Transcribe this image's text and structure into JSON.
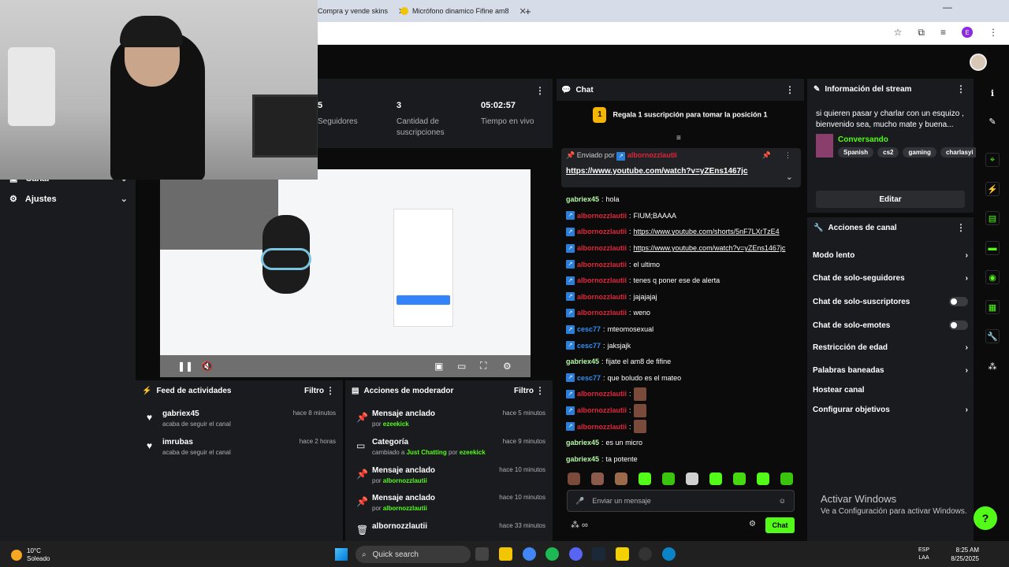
{
  "browser": {
    "tabs": [
      {
        "label": "Compra y vende skins"
      },
      {
        "label": "Micrófono dinamico Fifine am8"
      }
    ],
    "new_tab": "+",
    "profile_initial": "E"
  },
  "sidebar": {
    "items": [
      {
        "label": "Canal"
      },
      {
        "label": "Ajustes"
      }
    ]
  },
  "stats": [
    {
      "value": "5",
      "label": "Seguidores"
    },
    {
      "value": "3",
      "label": "Cantidad de suscripciones"
    },
    {
      "value": "05:02:57",
      "label": "Tiempo en vivo"
    }
  ],
  "activity_feed": {
    "title": "Feed de actividades",
    "filter": "Filtro",
    "items": [
      {
        "user": "gabriex45",
        "action": "acaba de seguir el canal",
        "time": "hace 8 minutos"
      },
      {
        "user": "imrubas",
        "action": "acaba de seguir el canal",
        "time": "hace 2 horas"
      }
    ]
  },
  "mod_actions": {
    "title": "Acciones de moderador",
    "filter": "Filtro",
    "items": [
      {
        "title": "Mensaje anclado",
        "prefix": "por",
        "detail": "ezeekick",
        "time": "hace 5 minutos"
      },
      {
        "title": "Categoría",
        "prefix": "cambiado a",
        "detail": "Just Chatting",
        "by": "por",
        "by_user": "ezeekick",
        "time": "hace 9 minutos"
      },
      {
        "title": "Mensaje anclado",
        "prefix": "por",
        "detail": "albornozzlautii",
        "time": "hace 10 minutos"
      },
      {
        "title": "Mensaje anclado",
        "prefix": "por",
        "detail": "albornozzlautii",
        "time": "hace 10 minutos"
      },
      {
        "title": "albornozzlautii",
        "prefix": "",
        "detail": "",
        "time": "hace 33 minutos"
      }
    ]
  },
  "chat": {
    "title": "Chat",
    "sub_goal": "Regala 1 suscripción para tomar la posición 1",
    "sub_goal_rank": "1",
    "pinned": {
      "by_label": "Enviado por",
      "user": "albornozzlautii",
      "url": "https://www.youtube.com/watch?v=yZEns1467jc"
    },
    "messages": [
      {
        "user": "gabriex45",
        "color": "green",
        "badge": false,
        "text": "hola"
      },
      {
        "user": "albornozzlautii",
        "color": "red",
        "badge": true,
        "text": "FIUM;BAAAA"
      },
      {
        "user": "albornozzlautii",
        "color": "red",
        "badge": true,
        "text": "https://www.youtube.com/shorts/5nF7LXrTzE4",
        "link": true
      },
      {
        "user": "albornozzlautii",
        "color": "red",
        "badge": true,
        "text": "https://www.youtube.com/watch?v=yZEns1467jc",
        "link": true
      },
      {
        "user": "albornozzlautii",
        "color": "red",
        "badge": true,
        "text": "el ultimo"
      },
      {
        "user": "albornozzlautii",
        "color": "red",
        "badge": true,
        "text": "tenes q poner ese de alerta"
      },
      {
        "user": "albornozzlautii",
        "color": "red",
        "badge": true,
        "text": "jajajajaj"
      },
      {
        "user": "albornozzlautii",
        "color": "red",
        "badge": true,
        "text": "weno"
      },
      {
        "user": "cesc77",
        "color": "blue",
        "badge": true,
        "text": "mteomosexual"
      },
      {
        "user": "cesc77",
        "color": "blue",
        "badge": true,
        "text": "jaksjajk"
      },
      {
        "user": "gabriex45",
        "color": "green",
        "badge": false,
        "text": "fijate el am8 de fifine"
      },
      {
        "user": "cesc77",
        "color": "blue",
        "badge": true,
        "text": "que boludo es el mateo"
      },
      {
        "user": "albornozzlautii",
        "color": "red",
        "badge": true,
        "text": "",
        "emote": true
      },
      {
        "user": "albornozzlautii",
        "color": "red",
        "badge": true,
        "text": "",
        "emote": true
      },
      {
        "user": "albornozzlautii",
        "color": "red",
        "badge": true,
        "text": "",
        "emote": true
      },
      {
        "user": "gabriex45",
        "color": "green",
        "badge": false,
        "text": "es un micro"
      },
      {
        "user": "gabriex45",
        "color": "green",
        "badge": false,
        "text": "ta potente"
      }
    ],
    "input_placeholder": "Enviar un mensaje",
    "send_label": "Chat"
  },
  "stream_info": {
    "title": "Información del stream",
    "description": "si quieren pasar y charlar con un esquizo , bienvenido sea, mucho mate y buena...",
    "category": "Conversando",
    "tags": [
      "Spanish",
      "cs2",
      "gaming",
      "charlasyi"
    ],
    "edit_label": "Editar"
  },
  "channel_actions": {
    "title": "Acciones de canal",
    "items": [
      {
        "label": "Modo lento",
        "control": "chevron"
      },
      {
        "label": "Chat de solo-seguidores",
        "control": "chevron"
      },
      {
        "label": "Chat de solo-suscriptores",
        "control": "toggle"
      },
      {
        "label": "Chat de solo-emotes",
        "control": "toggle"
      },
      {
        "label": "Restricción de edad",
        "control": "chevron"
      },
      {
        "label": "Palabras baneadas",
        "control": "chevron"
      },
      {
        "label": "Hostear canal",
        "control": "none"
      },
      {
        "label": "Configurar objetivos",
        "control": "chevron"
      }
    ]
  },
  "windows_activation": {
    "title": "Activar Windows",
    "subtitle": "Ve a Configuración para activar Windows."
  },
  "taskbar": {
    "temperature": "10°C",
    "weather": "Soleado",
    "search": "Quick search",
    "lang_top": "ESP",
    "lang_bottom": "LAA",
    "time": "8:25 AM",
    "date": "8/25/2025"
  },
  "colors": {
    "accent": "#53fc18",
    "panel": "#191b1f",
    "bg": "#0b0b0c",
    "user_red": "#e0263a",
    "user_blue": "#2f8ff5"
  }
}
